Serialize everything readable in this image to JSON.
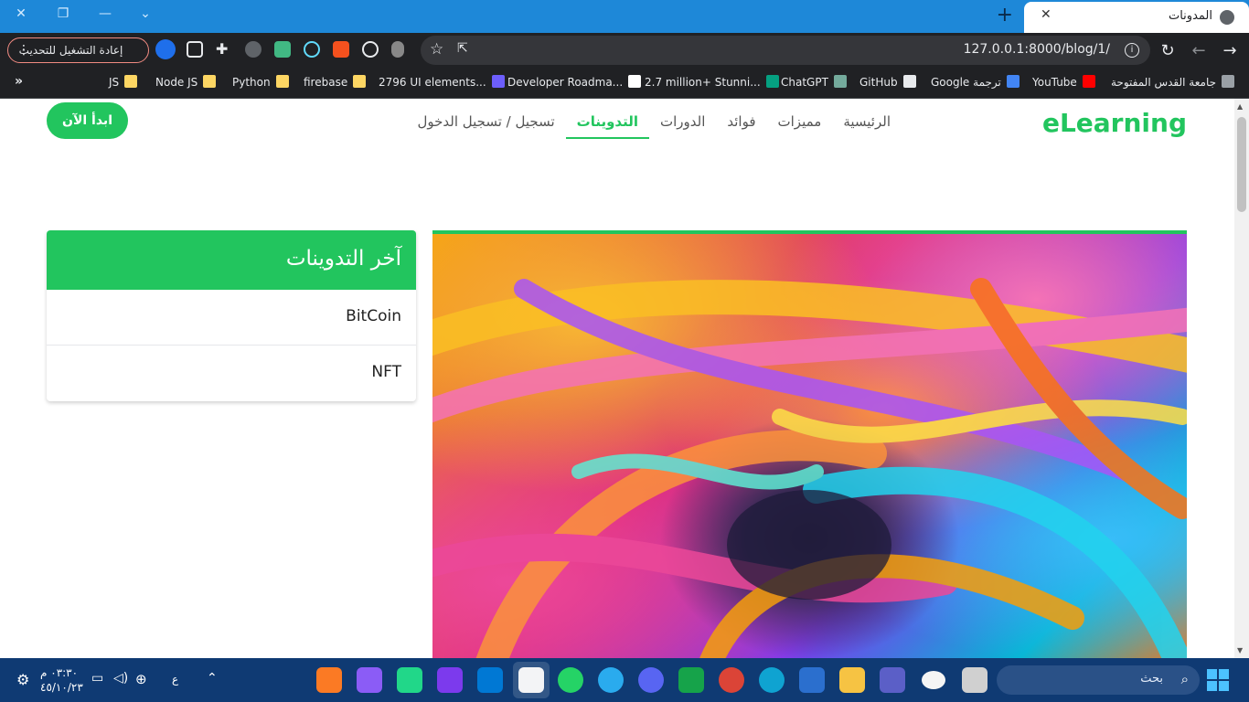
{
  "browser": {
    "tab_title": "المدونات",
    "url": "127.0.0.1:8000/blog/1/",
    "relaunch_label": "إعادة التشغيل للتحديث",
    "bookmarks": [
      {
        "label": "جامعة القدس المفتوحة",
        "color": "#9aa0a6"
      },
      {
        "label": "YouTube",
        "color": "#ff0000"
      },
      {
        "label": "Google ترجمة",
        "color": "#4285f4"
      },
      {
        "label": "GitHub",
        "color": "#e8eaed"
      },
      {
        "label": "ChatGPT",
        "color": "#74aa9c"
      },
      {
        "label": "2.7 million+ Stunni...",
        "color": "#05a081"
      },
      {
        "label": "Developer Roadma...",
        "color": "#ffffff"
      },
      {
        "label": "2796 UI elements...",
        "color": "#6d5efc"
      },
      {
        "label": "firebase",
        "color": "#fdd663"
      },
      {
        "label": "Python",
        "color": "#fdd663"
      },
      {
        "label": "Node JS",
        "color": "#fdd663"
      },
      {
        "label": "JS",
        "color": "#fdd663"
      }
    ],
    "more_bookmarks": "»"
  },
  "site": {
    "brand": "eLearning",
    "nav": [
      {
        "label": "الرئيسية",
        "active": false
      },
      {
        "label": "مميزات",
        "active": false
      },
      {
        "label": "فوائد",
        "active": false
      },
      {
        "label": "الدورات",
        "active": false
      },
      {
        "label": "التدوينات",
        "active": true
      },
      {
        "label": "تسجيل / تسجيل الدخول",
        "active": false
      }
    ],
    "cta_label": "ابدأ الآن",
    "accent_color": "#22c55e"
  },
  "sidebar": {
    "title": "آخر التدوينات",
    "posts": [
      "BitCoin",
      "NFT"
    ]
  },
  "taskbar": {
    "search_placeholder": "بحث",
    "time": "٠٣:٣٠ م",
    "date": "٤٥/١٠/٢٣",
    "lang": "ع"
  }
}
